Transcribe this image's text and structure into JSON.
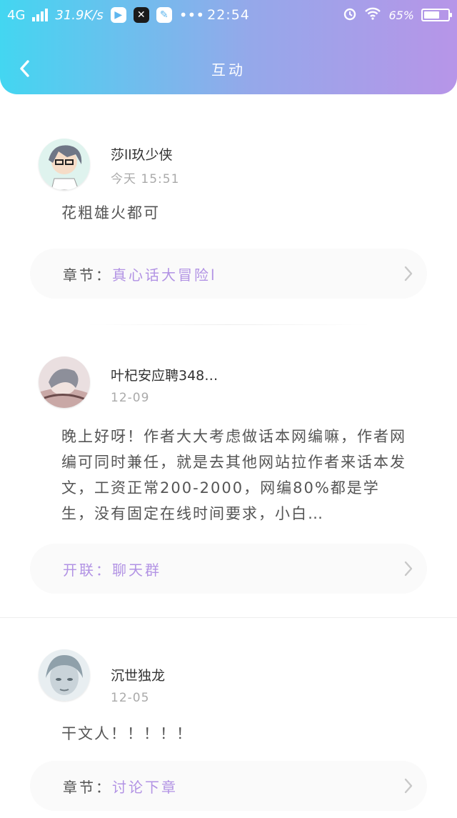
{
  "status_bar": {
    "network": "4G",
    "speed": "31.9K/s",
    "time": "22:54",
    "battery_percent": "65%",
    "battery_level": 0.65
  },
  "nav": {
    "title": "互动",
    "back_icon": "chevron-left-icon"
  },
  "posts": [
    {
      "name": "莎ll玖少侠",
      "time": "今天 15:51",
      "content": "花粗雄火都可",
      "ref_label": "章节：",
      "ref_value": "真心话大冒险l"
    },
    {
      "name": "叶杞安应聘348…",
      "time": "12-09",
      "content": "晚上好呀！作者大大考虑做话本网编嘛，作者网编可同时兼任，就是去其他网站拉作者来话本发文，工资正常200-2000，网编80%都是学生，没有固定在线时间要求，小白…",
      "ref_label": "开联：",
      "ref_value": "聊天群"
    },
    {
      "name": "沉世独龙",
      "time": "12-05",
      "content": "干文人！！！！！",
      "ref_label": "章节：",
      "ref_value": "讨论下章"
    }
  ],
  "colors": {
    "header_gradient_start": "#43d6f1",
    "header_gradient_end": "#b795e8",
    "accent_purple": "#b293e4"
  }
}
